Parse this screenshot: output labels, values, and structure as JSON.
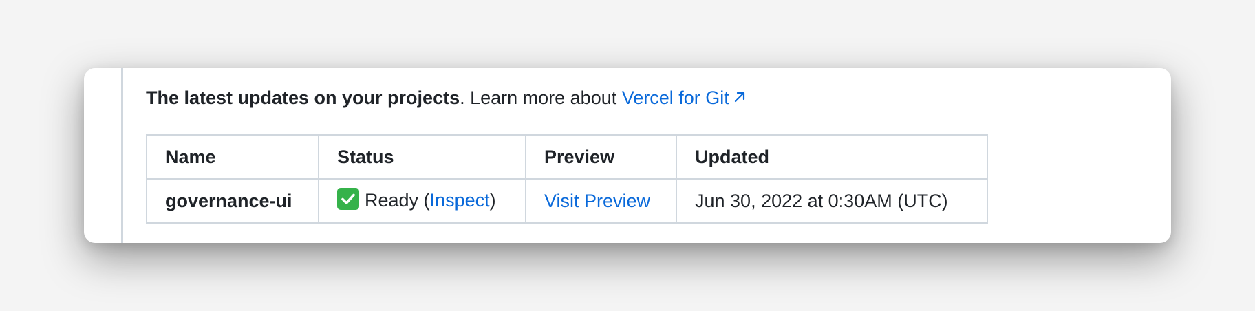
{
  "intro": {
    "bold": "The latest updates on your projects",
    "rest": ". Learn more about ",
    "link": "Vercel for Git"
  },
  "table": {
    "headers": [
      "Name",
      "Status",
      "Preview",
      "Updated"
    ],
    "rows": [
      {
        "name": "governance-ui",
        "status_icon": "check-mark-button-emoji",
        "status": "Ready (",
        "inspect": "Inspect",
        "status_close": ")",
        "preview": "Visit Preview",
        "updated": "Jun 30, 2022 at 0:30AM (UTC)"
      }
    ]
  },
  "colors": {
    "link": "#0969da",
    "text": "#1f2328",
    "border": "#d0d7de",
    "check": "#35b24a"
  }
}
